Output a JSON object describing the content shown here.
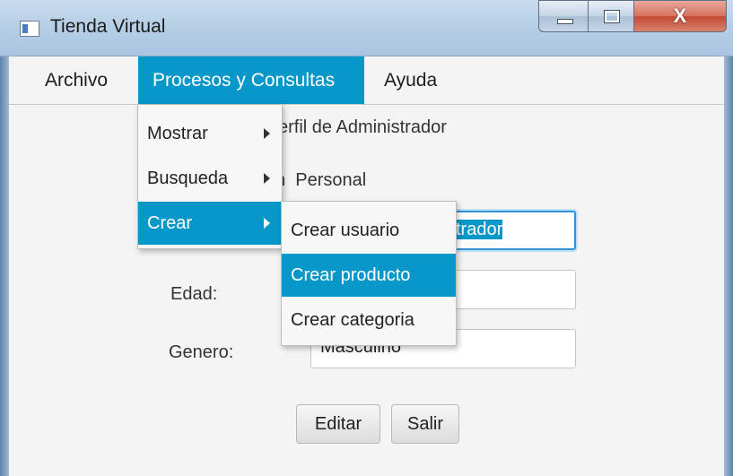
{
  "window": {
    "title": "Tienda Virtual",
    "icon": "app-icon",
    "controls": {
      "minimize": "minimize-icon",
      "maximize": "maximize-icon",
      "close_glyph": "X"
    }
  },
  "menubar": {
    "items": [
      {
        "label": "Archivo"
      },
      {
        "label": "Procesos y Consultas"
      },
      {
        "label": "Ayuda"
      }
    ]
  },
  "menu_procesos": {
    "items": [
      {
        "label": "Mostrar",
        "has_submenu": true
      },
      {
        "label": "Busqueda",
        "has_submenu": true
      },
      {
        "label": "Crear",
        "has_submenu": true
      }
    ]
  },
  "submenu_crear": {
    "items": [
      {
        "label": "Crear usuario"
      },
      {
        "label": "Crear producto"
      },
      {
        "label": "Crear categoria"
      }
    ]
  },
  "form": {
    "heading_fragment": "erfil de Administrador",
    "section_fragment": "n  Personal",
    "name_value_visible": "trador",
    "edad_label": "Edad:",
    "edad_value": "",
    "genero_label": "Genero:",
    "genero_value": "Masculino",
    "edit_button": "Editar",
    "exit_button": "Salir"
  },
  "colors": {
    "accent": "#0897c9",
    "focus_border": "#2f94d6",
    "background": "#f4f4f4"
  }
}
